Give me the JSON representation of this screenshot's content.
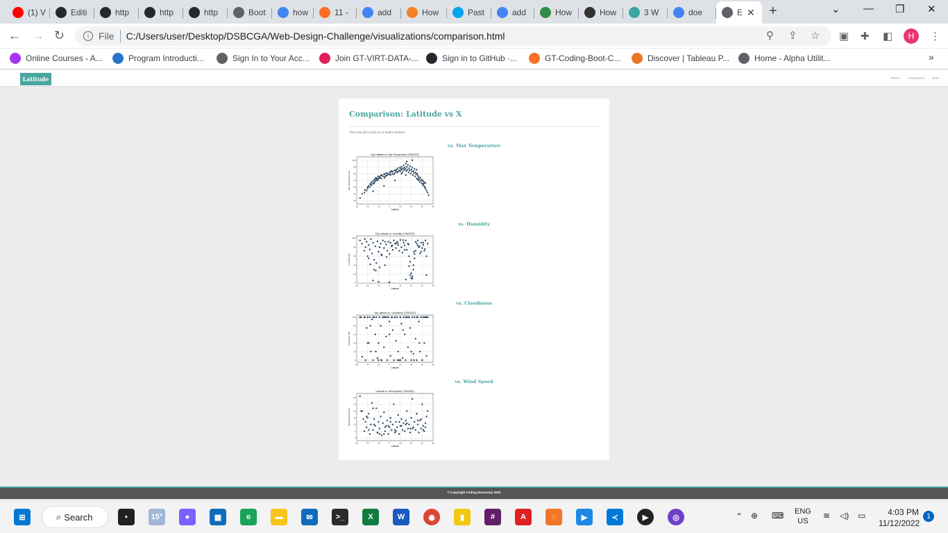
{
  "browser": {
    "tabs": [
      {
        "title": "(1) V",
        "icon": "youtube-icon",
        "color": "#ff0000"
      },
      {
        "title": "Editi",
        "icon": "github-icon",
        "color": "#24292f"
      },
      {
        "title": "http",
        "icon": "github-icon",
        "color": "#24292f"
      },
      {
        "title": "http",
        "icon": "github-icon",
        "color": "#24292f"
      },
      {
        "title": "http",
        "icon": "github-icon",
        "color": "#24292f"
      },
      {
        "title": "Boot",
        "icon": "globe-icon",
        "color": "#5f6368"
      },
      {
        "title": "how",
        "icon": "google-icon",
        "color": "#4285f4"
      },
      {
        "title": "11 -",
        "icon": "gitlab-icon",
        "color": "#fc6d26"
      },
      {
        "title": "add",
        "icon": "google-icon",
        "color": "#4285f4"
      },
      {
        "title": "How",
        "icon": "stackoverflow-icon",
        "color": "#f48024"
      },
      {
        "title": "Past",
        "icon": "windows-icon",
        "color": "#00a4ef"
      },
      {
        "title": "add",
        "icon": "google-icon",
        "color": "#4285f4"
      },
      {
        "title": "How",
        "icon": "geeks-icon",
        "color": "#2f8d46"
      },
      {
        "title": "How",
        "icon": "w3-icon",
        "color": "#333333"
      },
      {
        "title": "3 W",
        "icon": "globe-icon",
        "color": "#3aa7a0"
      },
      {
        "title": "doe",
        "icon": "google-icon",
        "color": "#4285f4"
      },
      {
        "title": "E",
        "icon": "globe-icon",
        "color": "#5f6368"
      }
    ],
    "address_scheme": "File",
    "address_url": "C:/Users/user/Desktop/DSBCGA/Web-Design-Challenge/visualizations/comparison.html",
    "profile_initial": "H",
    "bookmarks": [
      {
        "label": "Online Courses - A...",
        "icon": "udemy-icon",
        "color": "#a435f0"
      },
      {
        "label": "Program Introducti...",
        "icon": "coursera-icon",
        "color": "#2a73cc"
      },
      {
        "label": "Sign In to Your Acc...",
        "icon": "globe-icon",
        "color": "#5f6368"
      },
      {
        "label": "Join GT-VIRT-DATA-...",
        "icon": "slack-icon",
        "color": "#e01e5a"
      },
      {
        "label": "Sign in to GitHub ·...",
        "icon": "github-icon",
        "color": "#24292f"
      },
      {
        "label": "GT-Coding-Boot-C...",
        "icon": "gitlab-icon",
        "color": "#fc6d26"
      },
      {
        "label": "Discover | Tableau P...",
        "icon": "tableau-icon",
        "color": "#e97627"
      },
      {
        "label": "Home - Alpha Utilit...",
        "icon": "globe-icon",
        "color": "#5f6368"
      }
    ]
  },
  "site": {
    "brand": "Latitude",
    "nav": [
      "Plots ▾",
      "Comparison",
      "Data"
    ],
    "title": "Comparison: Latitude vs X",
    "hint": "Click any plot to get an in-depth analysis.",
    "sections": [
      {
        "heading": "vs. Max Temperature"
      },
      {
        "heading": "vs. Humidity"
      },
      {
        "heading": "vs. Cloudiness"
      },
      {
        "heading": "vs. Wind Speed"
      }
    ],
    "footer": "© Copyright Coding Bootcamp 2022"
  },
  "chart_data": [
    {
      "type": "scatter",
      "title": "City Latitude vs. Max Temperature (7/26/2022)",
      "xlabel": "Latitude",
      "ylabel": "Max Temperature (F)",
      "xlim": [
        -60,
        80
      ],
      "ylim": [
        35,
        105
      ],
      "xticks": [
        -60,
        -40,
        -20,
        0,
        20,
        40,
        60,
        80
      ],
      "yticks": [
        40,
        50,
        60,
        70,
        80,
        90,
        100
      ],
      "grid": true,
      "color": "#1f3f5f",
      "x": [
        -54,
        -50,
        -46,
        -45,
        -42,
        -40,
        -38,
        -36,
        -35,
        -34,
        -33,
        -32,
        -30,
        -29,
        -28,
        -27,
        -26,
        -25,
        -24,
        -23,
        -22,
        -21,
        -20,
        -19,
        -18,
        -16,
        -15,
        -14,
        -12,
        -10,
        -9,
        -8,
        -6,
        -5,
        -4,
        -2,
        0,
        1,
        2,
        4,
        5,
        6,
        8,
        9,
        10,
        12,
        13,
        14,
        15,
        16,
        18,
        19,
        20,
        21,
        22,
        23,
        24,
        25,
        26,
        27,
        28,
        29,
        30,
        31,
        32,
        33,
        34,
        35,
        36,
        37,
        38,
        39,
        40,
        41,
        42,
        43,
        44,
        45,
        46,
        47,
        48,
        49,
        50,
        51,
        52,
        53,
        54,
        55,
        56,
        57,
        58,
        59,
        60,
        61,
        62,
        63,
        64,
        65,
        66,
        68,
        70,
        72,
        -40,
        -28,
        -18,
        -8,
        2,
        12,
        22,
        32,
        42,
        52,
        62,
        -30,
        -10,
        10,
        30,
        50,
        66
      ],
      "y": [
        44,
        50,
        52,
        56,
        55,
        58,
        62,
        60,
        64,
        66,
        63,
        68,
        65,
        70,
        67,
        72,
        69,
        74,
        71,
        73,
        70,
        76,
        72,
        74,
        75,
        77,
        73,
        78,
        76,
        79,
        74,
        80,
        77,
        81,
        78,
        80,
        79,
        82,
        78,
        84,
        80,
        83,
        79,
        85,
        81,
        84,
        86,
        82,
        88,
        83,
        85,
        89,
        84,
        87,
        90,
        86,
        82,
        88,
        92,
        85,
        89,
        87,
        95,
        84,
        90,
        86,
        93,
        82,
        88,
        85,
        91,
        80,
        86,
        83,
        89,
        78,
        84,
        81,
        87,
        76,
        82,
        79,
        73,
        80,
        77,
        70,
        75,
        72,
        68,
        74,
        70,
        66,
        71,
        64,
        69,
        62,
        67,
        60,
        58,
        55,
        52,
        48,
        60,
        66,
        74,
        76,
        83,
        85,
        80,
        98,
        100,
        72,
        65,
        54,
        62,
        70,
        78,
        86,
        66,
        52
      ]
    },
    {
      "type": "scatter",
      "title": "City Latitude vs. Humidity (7/26/2022)",
      "xlabel": "Latitude",
      "ylabel": "Humidity (%)",
      "xlim": [
        -60,
        80
      ],
      "ylim": [
        0,
        105
      ],
      "xticks": [
        -60,
        -40,
        -20,
        0,
        20,
        40,
        60,
        80
      ],
      "yticks": [
        0,
        20,
        40,
        60,
        80,
        100
      ],
      "grid": true,
      "color": "#1f3f5f",
      "x": [
        -54,
        -50,
        -46,
        -44,
        -42,
        -40,
        -38,
        -36,
        -34,
        -32,
        -30,
        -28,
        -26,
        -24,
        -22,
        -20,
        -18,
        -16,
        -14,
        -12,
        -10,
        -8,
        -6,
        -4,
        -2,
        0,
        2,
        4,
        6,
        8,
        10,
        12,
        14,
        16,
        18,
        20,
        22,
        24,
        26,
        28,
        30,
        32,
        34,
        36,
        38,
        40,
        42,
        44,
        46,
        48,
        50,
        52,
        54,
        56,
        58,
        60,
        62,
        64,
        66,
        68,
        70,
        -45,
        -35,
        -25,
        -15,
        -5,
        5,
        15,
        25,
        35,
        45,
        55,
        65,
        -38,
        -28,
        -18,
        -8,
        12,
        28,
        38,
        40,
        42,
        44,
        46,
        48,
        52,
        58,
        62,
        68,
        -30,
        -20,
        0,
        30,
        36
      ],
      "y": [
        95,
        88,
        72,
        80,
        92,
        60,
        85,
        75,
        98,
        66,
        90,
        52,
        82,
        45,
        93,
        70,
        35,
        88,
        62,
        95,
        78,
        40,
        86,
        72,
        92,
        65,
        90,
        82,
        74,
        95,
        88,
        78,
        92,
        85,
        72,
        96,
        80,
        68,
        90,
        84,
        95,
        74,
        88,
        60,
        48,
        22,
        15,
        30,
        55,
        72,
        88,
        95,
        80,
        66,
        90,
        78,
        85,
        72,
        95,
        60,
        88,
        98,
        42,
        28,
        64,
        58,
        84,
        90,
        96,
        86,
        70,
        82,
        76,
        55,
        30,
        80,
        92,
        88,
        74,
        18,
        12,
        10,
        40,
        65,
        92,
        84,
        70,
        90,
        18,
        6,
        3,
        2,
        8,
        38
      ],
      "note": ""
    },
    {
      "type": "scatter",
      "title": "City Latitude vs. Cloudiness (7/26/2022)",
      "xlabel": "Latitude",
      "ylabel": "Cloudiness (%)",
      "xlim": [
        -60,
        80
      ],
      "ylim": [
        -5,
        105
      ],
      "xticks": [
        -60,
        -40,
        -20,
        0,
        20,
        40,
        60,
        80
      ],
      "yticks": [
        0,
        20,
        40,
        60,
        80,
        100
      ],
      "grid": true,
      "color": "#1f3f5f",
      "x": [
        -54,
        -50,
        -46,
        -44,
        -42,
        -40,
        -38,
        -36,
        -34,
        -32,
        -30,
        -28,
        -26,
        -24,
        -22,
        -20,
        -18,
        -16,
        -14,
        -12,
        -10,
        -8,
        -6,
        -4,
        -2,
        0,
        2,
        4,
        6,
        8,
        10,
        12,
        14,
        16,
        18,
        20,
        22,
        24,
        26,
        28,
        30,
        32,
        34,
        36,
        38,
        40,
        42,
        44,
        46,
        48,
        50,
        52,
        54,
        56,
        58,
        60,
        62,
        64,
        66,
        68,
        70,
        -52,
        -40,
        -30,
        -20,
        -10,
        0,
        10,
        20,
        30,
        40,
        50,
        60,
        68,
        -45,
        -25,
        -5,
        15,
        35,
        55,
        -35,
        -15,
        5,
        25,
        45,
        65
      ],
      "y": [
        100,
        8,
        100,
        0,
        75,
        100,
        40,
        100,
        20,
        95,
        0,
        100,
        60,
        100,
        5,
        40,
        100,
        80,
        0,
        100,
        30,
        100,
        55,
        0,
        100,
        90,
        10,
        100,
        70,
        0,
        100,
        45,
        100,
        20,
        0,
        100,
        85,
        5,
        100,
        60,
        0,
        100,
        30,
        100,
        75,
        0,
        100,
        15,
        100,
        50,
        0,
        100,
        90,
        20,
        100,
        0,
        100,
        40,
        100,
        10,
        100,
        100,
        40,
        100,
        0,
        100,
        60,
        100,
        0,
        100,
        20,
        100,
        0,
        100,
        100,
        20,
        100,
        0,
        100,
        40,
        80,
        0,
        100,
        70,
        0,
        100
      ],
      "note": ""
    },
    {
      "type": "scatter",
      "title": "Latitude vs. Wind Speed (7/26/2022)",
      "xlabel": "Latitude",
      "ylabel": "Wind Speed (mph)",
      "xlim": [
        -60,
        80
      ],
      "ylim": [
        -2,
        33
      ],
      "xticks": [
        -60,
        -40,
        -20,
        0,
        20,
        40,
        60,
        80
      ],
      "yticks": [
        0,
        5,
        10,
        15,
        20,
        25,
        30
      ],
      "grid": true,
      "color": "#1f3f5f",
      "x": [
        -54,
        -52,
        -50,
        -46,
        -44,
        -42,
        -40,
        -38,
        -36,
        -34,
        -32,
        -30,
        -28,
        -26,
        -24,
        -22,
        -20,
        -18,
        -16,
        -14,
        -12,
        -10,
        -8,
        -6,
        -4,
        -2,
        0,
        2,
        4,
        6,
        8,
        10,
        12,
        14,
        16,
        18,
        20,
        22,
        24,
        26,
        28,
        30,
        32,
        34,
        36,
        38,
        40,
        42,
        44,
        46,
        48,
        50,
        52,
        54,
        56,
        58,
        60,
        62,
        64,
        66,
        68,
        70,
        -48,
        -38,
        -28,
        -18,
        -8,
        2,
        12,
        22,
        32,
        42,
        52,
        62,
        -42,
        -22,
        -2,
        18,
        38,
        58,
        -30,
        -10,
        10,
        30,
        50,
        66
      ],
      "y": [
        31,
        20,
        20,
        5,
        12,
        8,
        15,
        18,
        3,
        10,
        26,
        6,
        14,
        9,
        22,
        4,
        12,
        7,
        16,
        2,
        11,
        19,
        5,
        9,
        13,
        3,
        8,
        15,
        6,
        10,
        25,
        4,
        12,
        8,
        17,
        3,
        9,
        14,
        6,
        11,
        5,
        13,
        20,
        7,
        10,
        4,
        15,
        29,
        8,
        12,
        6,
        18,
        10,
        4,
        13,
        7,
        25,
        9,
        5,
        11,
        16,
        20,
        14,
        6,
        10,
        3,
        8,
        12,
        5,
        9,
        11,
        7,
        13,
        6,
        16,
        4,
        9,
        12,
        7,
        14,
        22,
        3,
        6,
        10,
        18,
        8
      ]
    }
  ]
}
